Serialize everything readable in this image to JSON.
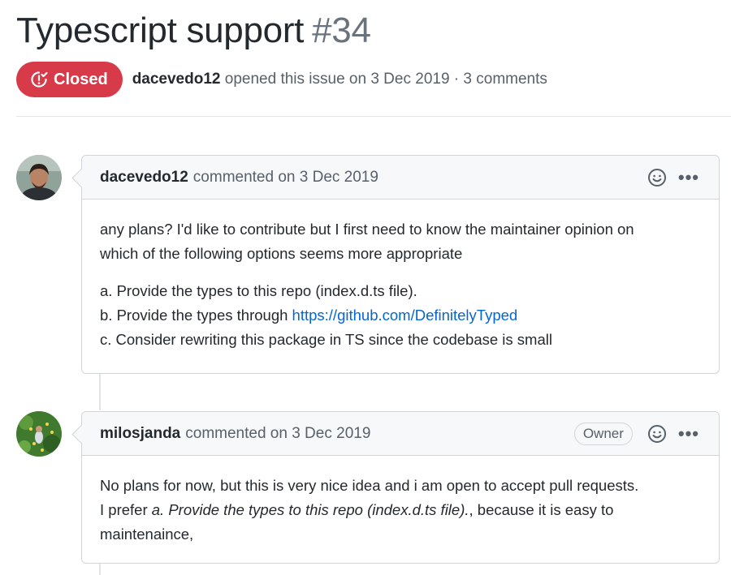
{
  "issue": {
    "title": "Typescript support",
    "number": "#34",
    "state": "Closed",
    "author": "dacevedo12",
    "opened_text": "opened this issue on 3 Dec 2019 · 3 comments"
  },
  "comments": [
    {
      "author": "dacevedo12",
      "when": "commented on 3 Dec 2019",
      "para1_line1": "any plans? I'd like to contribute but I first need to know the maintainer opinion on",
      "para1_line2": "which of the following options seems more appropriate",
      "option_a": "a. Provide the types to this repo (index.d.ts file).",
      "option_b_prefix": "b. Provide the types through ",
      "option_b_link": "https://github.com/DefinitelyTyped",
      "option_c": "c. Consider rewriting this package in TS since the codebase is small"
    },
    {
      "author": "milosjanda",
      "when": "commented on 3 Dec 2019",
      "badge": "Owner",
      "line1": "No plans for now, but this is very nice idea and i am open to accept pull requests.",
      "line2_prefix": "I prefer ",
      "line2_em": "a. Provide the types to this repo (index.d.ts file).",
      "line2_suffix": ", because it is easy to",
      "line3": "maintenaince,"
    }
  ],
  "colors": {
    "closed": "#d73a49",
    "link": "#0366d6",
    "muted": "#586069",
    "border": "#d1d5da",
    "header_bg": "#f6f8fa"
  },
  "icons": {
    "state": "issue-closed-icon",
    "reaction": "smiley-icon",
    "more": "kebab-horizontal-icon"
  }
}
